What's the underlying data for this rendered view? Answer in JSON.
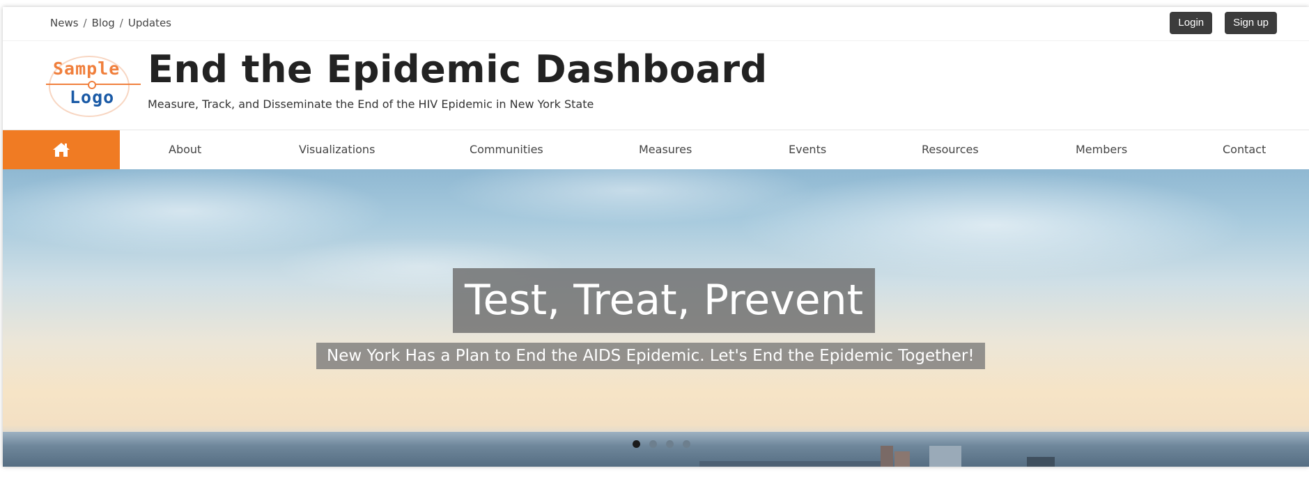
{
  "topbar": {
    "breadcrumbs": [
      "News",
      "Blog",
      "Updates"
    ],
    "login_label": "Login",
    "signup_label": "Sign up"
  },
  "header": {
    "logo_line1": "Sample",
    "logo_line2": "Logo",
    "title": "End the Epidemic Dashboard",
    "subtitle": "Measure, Track, and Disseminate the End of the HIV Epidemic in New York State"
  },
  "nav": {
    "home_icon": "home-icon",
    "items": [
      "About",
      "Visualizations",
      "Communities",
      "Measures",
      "Events",
      "Resources",
      "Members",
      "Contact"
    ],
    "accent_color": "#f07b23"
  },
  "hero": {
    "headline": "Test, Treat, Prevent",
    "tagline": "New York Has a Plan to End the AIDS Epidemic. Let's End the Epidemic Together!",
    "slide_count": 4,
    "active_slide": 1
  }
}
